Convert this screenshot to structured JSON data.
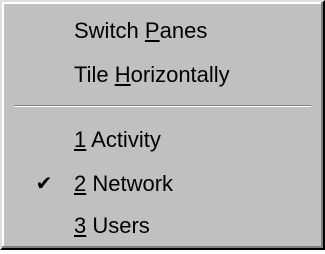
{
  "menu": {
    "items": [
      {
        "pre": "Switch ",
        "key": "P",
        "post": "anes",
        "checked": false
      },
      {
        "pre": "Tile ",
        "key": "H",
        "post": "orizontally",
        "checked": false
      },
      {
        "pre": "",
        "key": "1",
        "post": " Activity",
        "checked": false
      },
      {
        "pre": "",
        "key": "2",
        "post": " Network",
        "checked": true
      },
      {
        "pre": "",
        "key": "3",
        "post": " Users",
        "checked": false
      }
    ],
    "check_glyph": "✔",
    "check_icon": "checkmark-icon"
  }
}
